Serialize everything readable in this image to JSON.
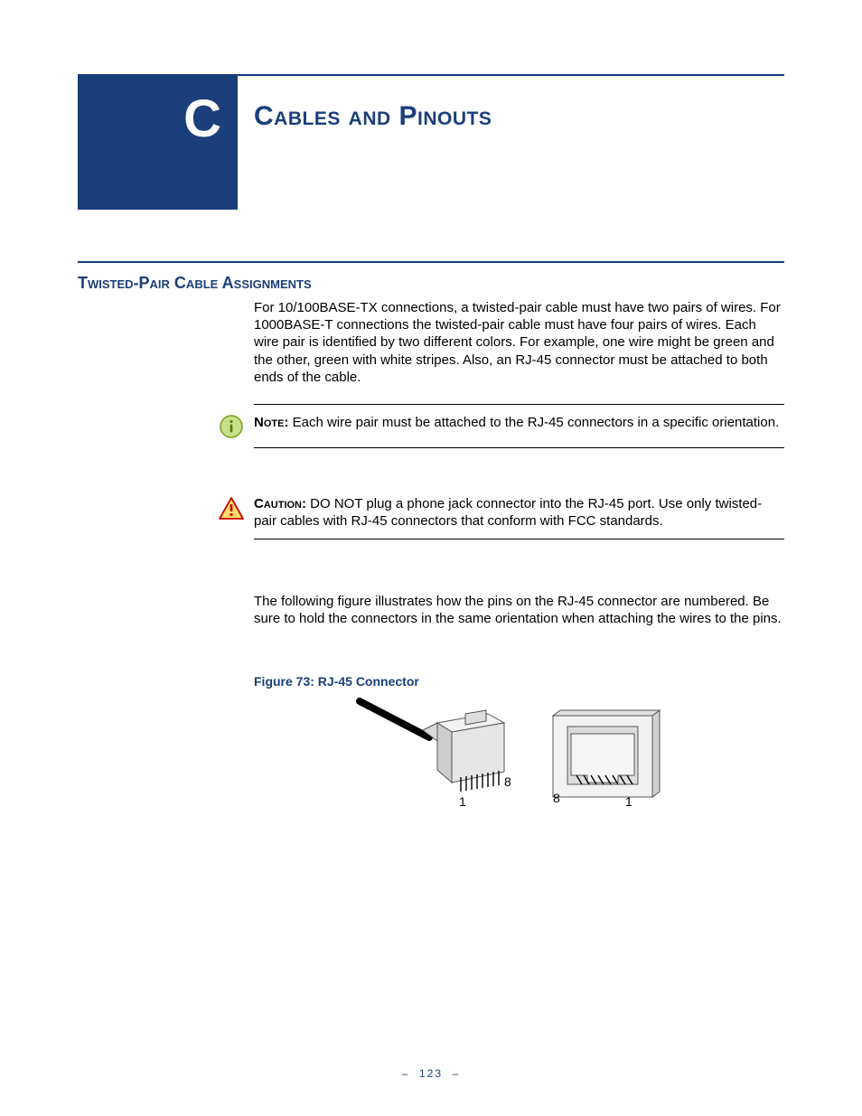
{
  "appendix_letter": "C",
  "chapter_title": "Cables and Pinouts",
  "section_title": "Twisted-Pair Cable Assignments",
  "para1": "For 10/100BASE-TX connections, a twisted-pair cable must have two pairs of wires. For 1000BASE-T connections the twisted-pair cable must have four pairs of wires. Each wire pair is identified by two different colors. For example, one wire might be green and the other, green with white stripes. Also, an RJ-45 connector must be attached to both ends of the cable.",
  "note_label": "Note:",
  "note_text": " Each wire pair must be attached to the RJ-45 connectors in a specific orientation.",
  "caution_label": "Caution:",
  "caution_text": " DO NOT plug a phone jack connector into the RJ-45 port. Use only twisted-pair cables with RJ-45 connectors that conform with FCC standards.",
  "para2": "The following figure illustrates how the pins on the RJ-45 connector are numbered. Be sure to hold the connectors in the same orientation when attaching the wires to the pins.",
  "figure_caption": "Figure 73:  RJ-45 Connector",
  "figure_labels": {
    "plug_left": "1",
    "plug_right": "8",
    "jack_left": "8",
    "jack_right": "1"
  },
  "page_number": "123",
  "colors": {
    "brand": "#1a3f7a",
    "note_green": "#9ac43c",
    "caution_yellow": "#f9d24a",
    "caution_border": "#cc0000"
  }
}
